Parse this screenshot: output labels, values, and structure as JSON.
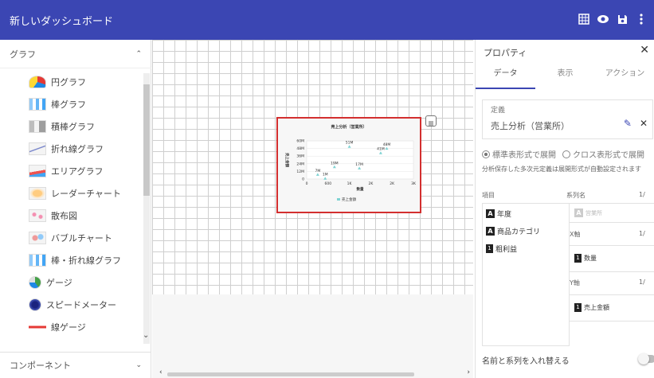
{
  "app": {
    "title": "新しいダッシュボード"
  },
  "sidebar": {
    "section_title": "グラフ",
    "items": [
      {
        "label": "円グラフ",
        "icon": "pie-chart-icon"
      },
      {
        "label": "棒グラフ",
        "icon": "bar-chart-icon"
      },
      {
        "label": "積棒グラフ",
        "icon": "stacked-bar-chart-icon"
      },
      {
        "label": "折れ線グラフ",
        "icon": "line-chart-icon"
      },
      {
        "label": "エリアグラフ",
        "icon": "area-chart-icon"
      },
      {
        "label": "レーダーチャート",
        "icon": "radar-chart-icon"
      },
      {
        "label": "散布図",
        "icon": "scatter-chart-icon"
      },
      {
        "label": "バブルチャート",
        "icon": "bubble-chart-icon"
      },
      {
        "label": "棒・折れ線グラフ",
        "icon": "bar-line-chart-icon"
      },
      {
        "label": "ゲージ",
        "icon": "gauge-icon"
      },
      {
        "label": "スピードメーター",
        "icon": "speedometer-icon"
      },
      {
        "label": "線ゲージ",
        "icon": "linear-gauge-icon"
      }
    ],
    "footer": "コンポーネント"
  },
  "chart_data": {
    "type": "scatter",
    "title": "売上分析（営業所）",
    "xlabel": "数量",
    "ylabel": "売上金額",
    "x_ticks": [
      "0",
      "600",
      "1K",
      "2K",
      "2K",
      "3K"
    ],
    "y_ticks": [
      "60M",
      "48M",
      "36M",
      "24M",
      "12M",
      "0"
    ],
    "xlim": [
      0,
      3000
    ],
    "ylim": [
      0,
      60
    ],
    "series": [
      {
        "name": "売上金額",
        "color": "#7fd3d3"
      }
    ],
    "points": [
      {
        "x": 310,
        "y": 7,
        "label": "7M"
      },
      {
        "x": 520,
        "y": 1,
        "label": "1M"
      },
      {
        "x": 780,
        "y": 19,
        "label": "19M"
      },
      {
        "x": 1200,
        "y": 51,
        "label": "51M"
      },
      {
        "x": 1480,
        "y": 17,
        "label": "17M"
      },
      {
        "x": 2080,
        "y": 41,
        "label": "41M"
      },
      {
        "x": 2250,
        "y": 48,
        "label": "48M"
      }
    ]
  },
  "properties": {
    "title": "プロパティ",
    "tabs": [
      "データ",
      "表示",
      "アクション"
    ],
    "definition_label": "定義",
    "definition_value": "売上分析（営業所）",
    "radio_standard": "標準表形式で展開",
    "radio_cross": "クロス表形式で展開",
    "note": "分析保存した多次元定義は展開形式が自動設定されます",
    "items_label": "項目",
    "fields": [
      {
        "tag": "A",
        "label": "年度"
      },
      {
        "tag": "A",
        "label": "商品カテゴリ"
      },
      {
        "tag": "1",
        "label": "粗利益"
      }
    ],
    "series_name_label": "系列名",
    "series_name_count": "1/",
    "series_name_field": "営業所",
    "x_axis_label": "X軸",
    "x_axis_count": "1/",
    "x_axis_field": "数量",
    "y_axis_label": "Y軸",
    "y_axis_count": "1/",
    "y_axis_field": "売上金額",
    "swap_label": "名前と系列を入れ替える"
  }
}
